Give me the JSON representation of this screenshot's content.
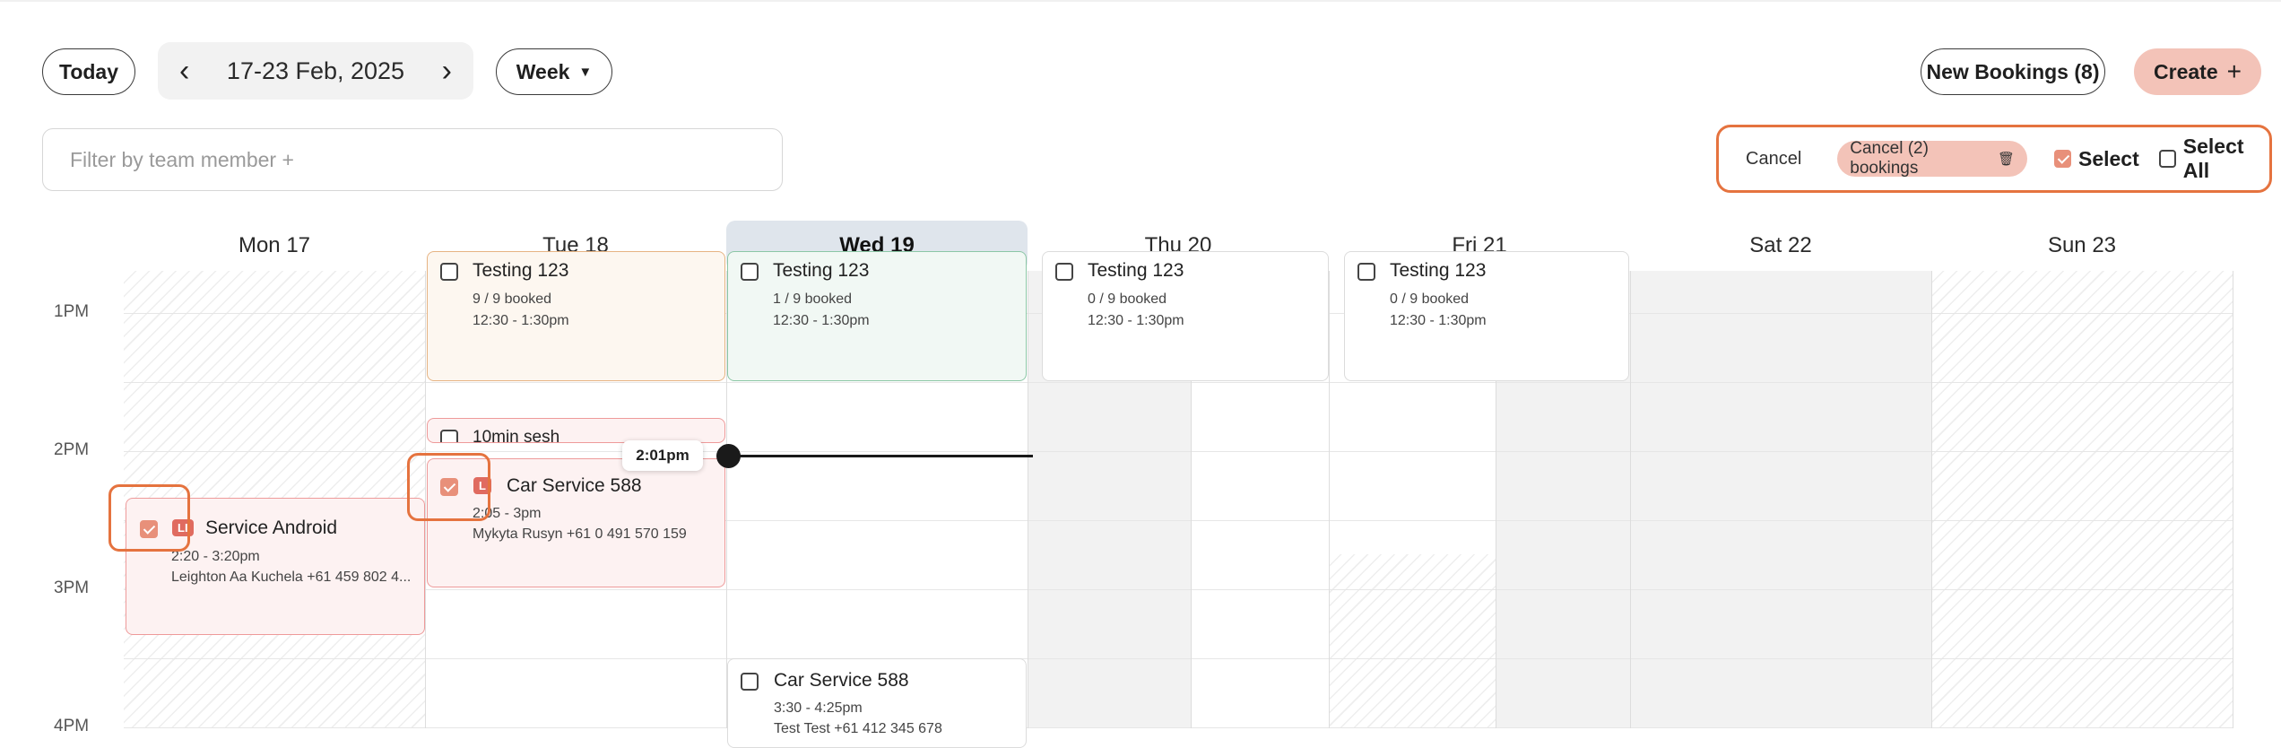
{
  "toolbar": {
    "today": "Today",
    "date_range": "17-23 Feb, 2025",
    "view": "Week",
    "new_bookings": "New Bookings (8)",
    "create": "Create",
    "create_plus": "+"
  },
  "filter": {
    "placeholder": "Filter by team member +"
  },
  "selection": {
    "cancel": "Cancel",
    "cancel_bookings": "Cancel (2) bookings",
    "select": "Select",
    "select_all": "Select All"
  },
  "days": [
    "Mon 17",
    "Tue 18",
    "Wed 19",
    "Thu 20",
    "Fri 21",
    "Sat 22",
    "Sun 23"
  ],
  "hours": [
    "1PM",
    "2PM",
    "3PM",
    "4PM"
  ],
  "now": "2:01pm",
  "events": {
    "tue_testing": {
      "title": "Testing 123",
      "booked": "9 / 9 booked",
      "time": "12:30 - 1:30pm"
    },
    "wed_testing": {
      "title": "Testing 123",
      "booked": "1 / 9 booked",
      "time": "12:30 - 1:30pm"
    },
    "thu_testing": {
      "title": "Testing 123",
      "booked": "0 / 9 booked",
      "time": "12:30 - 1:30pm"
    },
    "fri_testing": {
      "title": "Testing 123",
      "booked": "0 / 9 booked",
      "time": "12:30 - 1:30pm"
    },
    "tue_10min": {
      "title": "10min sesh"
    },
    "tue_car": {
      "badge": "L",
      "title": "Car Service 588",
      "time": "2:05 - 3pm",
      "person": "Mykyta Rusyn +61 0 491 570 159"
    },
    "mon_android": {
      "badge": "LI",
      "title": "Service Android",
      "time": "2:20 - 3:20pm",
      "person": "Leighton Aa Kuchela +61 459 802 4..."
    },
    "wed_car": {
      "title": "Car Service 588",
      "time": "3:30 - 4:25pm",
      "person": "Test Test +61 412 345 678"
    }
  },
  "colors": {
    "accent": "#e5733f",
    "create_bg": "#f3c3b8",
    "today_col": "#dfe5ec"
  }
}
